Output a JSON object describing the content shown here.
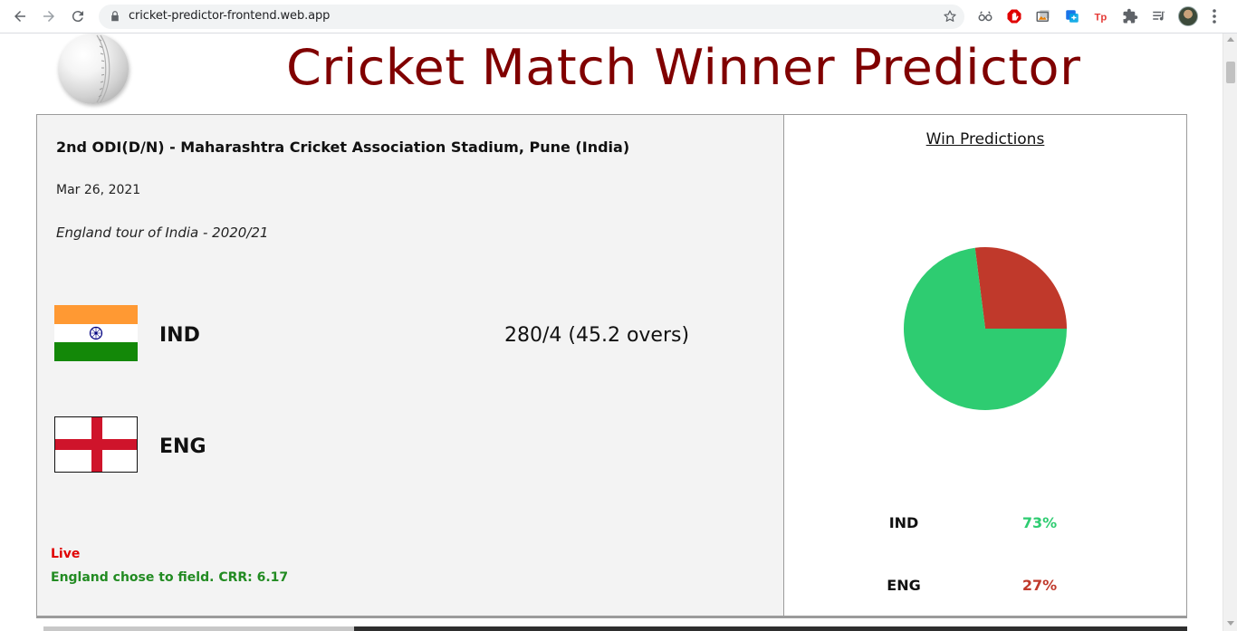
{
  "browser": {
    "url": "cricket-predictor-frontend.web.app",
    "icons": [
      "back-icon",
      "forward-icon",
      "reload-icon",
      "lock-icon",
      "star-icon",
      "extension-icons",
      "avatar",
      "menu-icon"
    ]
  },
  "app": {
    "title": "Cricket Match Winner Predictor",
    "title_color": "#800000"
  },
  "match": {
    "title": "2nd ODI(D/N) - Maharashtra Cricket Association Stadium, Pune (India)",
    "date": "Mar 26, 2021",
    "series": "England tour of India - 2020/21",
    "teams": [
      {
        "code": "IND",
        "score": "280/4 (45.2 overs)",
        "flag": "india-flag"
      },
      {
        "code": "ENG",
        "score": "",
        "flag": "england-flag"
      }
    ],
    "status_live": "Live",
    "status_text": "England chose to field. CRR: 6.17",
    "live_color": "#e00000",
    "status_color": "#228b22"
  },
  "predictions": {
    "heading": "Win Predictions",
    "rows": [
      {
        "team": "IND",
        "percent": "73%",
        "value": 73,
        "color": "#2ecc71"
      },
      {
        "team": "ENG",
        "percent": "27%",
        "value": 27,
        "color": "#c0392b"
      }
    ]
  }
}
